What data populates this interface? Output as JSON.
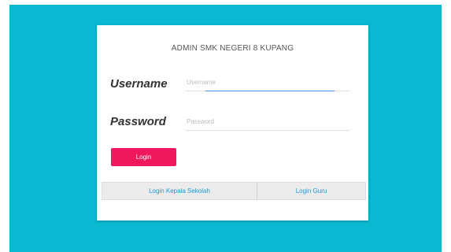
{
  "page": {
    "title": "ADMIN SMK NEGERI 8 KUPANG"
  },
  "form": {
    "username_label": "Username",
    "username_placeholder": "Username",
    "username_value": "",
    "password_label": "Password",
    "password_placeholder": "Password",
    "password_value": "",
    "login_label": "Login"
  },
  "links": {
    "kepala_sekolah": "Login Kepala Sekolah",
    "guru": "Login Guru"
  },
  "colors": {
    "background": "#0ab8d2",
    "login_button": "#f0185c",
    "link_text": "#1a9ad6",
    "focus_underline": "#4a90e2"
  }
}
